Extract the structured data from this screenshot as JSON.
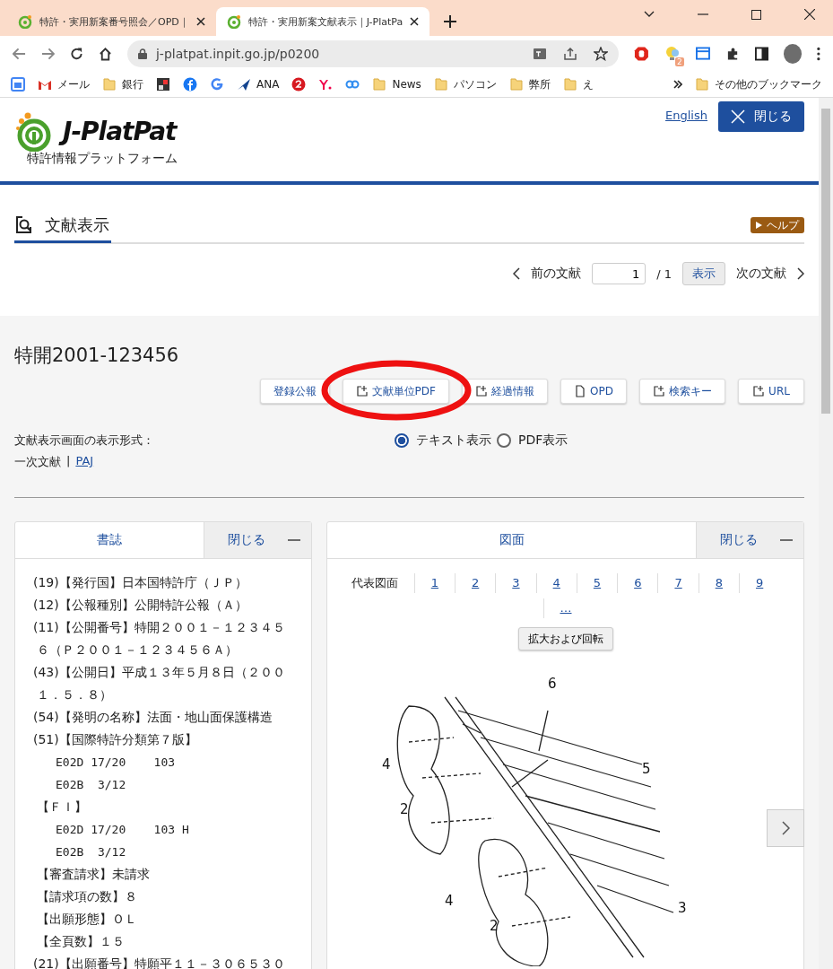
{
  "browser": {
    "tabs": [
      {
        "title": "特許・実用新案番号照会／OPD｜",
        "selected": false
      },
      {
        "title": "特許・実用新案文献表示｜J-PlatPa",
        "selected": true
      }
    ],
    "url": "j-platpat.inpit.go.jp/p0200",
    "extension_badge": "2",
    "bookmarks": [
      {
        "kind": "calendar"
      },
      {
        "label": "メール",
        "kind": "mail"
      },
      {
        "label": "銀行",
        "kind": "folder"
      },
      {
        "kind": "photo"
      },
      {
        "kind": "fb"
      },
      {
        "kind": "g"
      },
      {
        "label": "ANA",
        "kind": "plane"
      },
      {
        "kind": "jal"
      },
      {
        "kind": "yahoo"
      },
      {
        "kind": "rings"
      },
      {
        "label": "News",
        "kind": "folder"
      },
      {
        "label": "パソコン",
        "kind": "folder"
      },
      {
        "label": "弊所",
        "kind": "folder"
      },
      {
        "label": "え",
        "kind": "folder"
      }
    ],
    "other_bookmarks": "その他のブックマーク"
  },
  "header": {
    "logo": "J-PlatPat",
    "subtitle": "特許情報プラットフォーム",
    "english_link": "English",
    "close_button": "閉じる"
  },
  "page_tab": {
    "label": "文献表示",
    "help": "ヘルプ"
  },
  "pager": {
    "prev": "前の文献",
    "page": "1",
    "total": "/ 1",
    "show_button": "表示",
    "next": "次の文献"
  },
  "document": {
    "title": "特開2001-123456",
    "actions": [
      {
        "label": "登録公報",
        "kind": "plain"
      },
      {
        "label": "文献単位PDF",
        "kind": "external"
      },
      {
        "label": "経過情報",
        "kind": "external"
      },
      {
        "label": "OPD",
        "kind": "doc"
      },
      {
        "label": "検索キー",
        "kind": "external"
      },
      {
        "label": "URL",
        "kind": "external"
      }
    ],
    "format_label": "文献表示画面の表示形式：",
    "format_options": [
      {
        "label": "テキスト表示",
        "selected": true
      },
      {
        "label": "PDF表示",
        "selected": false
      }
    ],
    "primary_label": "一次文献",
    "separator": "|",
    "paj_link": "PAJ"
  },
  "biblio_panel": {
    "title": "書誌",
    "close": "閉じる",
    "lines": [
      {
        "text": "(19)【発行国】日本国特許庁（ＪＰ）",
        "kind": "item"
      },
      {
        "text": "(12)【公報種別】公開特許公報（Ａ）",
        "kind": "item"
      },
      {
        "text": "(11)【公開番号】特開２００１－１２３４５",
        "kind": "item"
      },
      {
        "text": "６（Ｐ２００１－１２３４５６Ａ）",
        "kind": "wrap"
      },
      {
        "text": "(43)【公開日】平成１３年５月８日（２００",
        "kind": "item"
      },
      {
        "text": "１．５．８）",
        "kind": "wrap"
      },
      {
        "text": "(54)【発明の名称】法面・地山面保護構造",
        "kind": "item"
      },
      {
        "text": "(51)【国際特許分類第７版】",
        "kind": "item"
      },
      {
        "text": "E02D 17/20    103",
        "kind": "code"
      },
      {
        "text": "E02B  3/12",
        "kind": "code"
      },
      {
        "text": "【ＦＩ】",
        "kind": "wrap"
      },
      {
        "text": "E02D 17/20    103 H",
        "kind": "code"
      },
      {
        "text": "E02B  3/12",
        "kind": "code"
      },
      {
        "text": "【審査請求】未請求",
        "kind": "wrap"
      },
      {
        "text": "【請求項の数】８",
        "kind": "wrap"
      },
      {
        "text": "【出願形態】ＯＬ",
        "kind": "wrap"
      },
      {
        "text": "【全頁数】１５",
        "kind": "wrap"
      },
      {
        "text": "(21)【出願番号】特願平１１－３０６５３０",
        "kind": "item"
      }
    ]
  },
  "figure_panel": {
    "title": "図面",
    "close": "閉じる",
    "representative": "代表図面",
    "figure_links": [
      "1",
      "2",
      "3",
      "4",
      "5",
      "6",
      "7",
      "8",
      "9",
      "…"
    ],
    "zoom_button": "拡大および回転",
    "figure_labels": [
      "6",
      "5",
      "4",
      "2",
      "4",
      "2",
      "3"
    ]
  }
}
